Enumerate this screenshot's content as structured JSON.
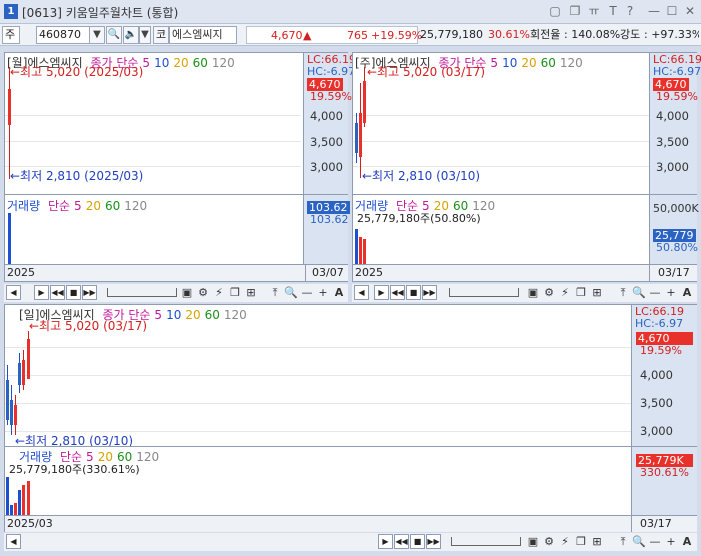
{
  "window": {
    "number": "1",
    "title": "[0613] 키움일주월차트 (통합)",
    "buttons": [
      "▢",
      "❐",
      "ㅠ",
      "T",
      "?",
      "—",
      "☐",
      "✕"
    ]
  },
  "toolbar": {
    "market": "주",
    "code": "460870",
    "code_dd": "▼",
    "search": "🔍",
    "sound": "🔈",
    "sound_dd": "▼",
    "kind": "코",
    "name": "에스엠씨지",
    "price": "4,670",
    "arrow": "▲",
    "change": "765",
    "rate": "+19.59%",
    "volume": "25,779,180",
    "vol_rate": "30.61%",
    "turnover_label": "회전율",
    "turnover": ": 140.08%",
    "strength_label": "강도",
    "strength": ": +97.33%"
  },
  "colors": {
    "up": "#e8312b",
    "down": "#2b63c2",
    "axis_bg": "#d9e3f1"
  },
  "panels": {
    "monthly": {
      "legend": {
        "name": "[월]에스엠씨지",
        "ma": "종가 단순",
        "ma5": "5",
        "ma10": "10",
        "ma20": "20",
        "ma60": "60",
        "ma120": "120"
      },
      "high": "←최고 5,020 (2025/03)",
      "low": "←최저 2,810 (2025/03)",
      "lc": "LC:66.19",
      "hc": "HC:-6.97",
      "price": "4,670",
      "pct": "19.59%",
      "ticks": [
        "4,000",
        "3,500",
        "3,000"
      ],
      "vol_legend": {
        "name": "거래량",
        "ma": "단순",
        "ma5": "5",
        "ma20": "20",
        "ma60": "60",
        "ma120": "120"
      },
      "vol_axis": [
        "103.62",
        "103.62"
      ],
      "date_left": "2025",
      "date_right": "03/07"
    },
    "weekly": {
      "legend": {
        "name": "[주]에스엠씨지",
        "ma": "종가 단순",
        "ma5": "5",
        "ma10": "10",
        "ma20": "20",
        "ma60": "60",
        "ma120": "120"
      },
      "high": "←최고 5,020 (03/17)",
      "low": "←최저 2,810 (03/10)",
      "lc": "LC:66.19",
      "hc": "HC:-6.97",
      "price": "4,670",
      "pct": "19.59%",
      "ticks": [
        "4,000",
        "3,500",
        "3,000"
      ],
      "vol_legend": {
        "name": "거래량",
        "ma": "단순",
        "ma5": "5",
        "ma20": "20",
        "ma60": "60",
        "ma120": "120"
      },
      "vol_text": "25,779,180주(50.80%)",
      "vol_axis": [
        "50,000K",
        "25,779",
        "50.80%"
      ],
      "date_left": "2025",
      "date_right": "03/17"
    },
    "daily": {
      "legend": {
        "name": "[일]에스엠씨지",
        "ma": "종가 단순",
        "ma5": "5",
        "ma10": "10",
        "ma20": "20",
        "ma60": "60",
        "ma120": "120"
      },
      "high": "←최고 5,020 (03/17)",
      "low": "←최저 2,810 (03/10)",
      "lc": "LC:66.19",
      "hc": "HC:-6.97",
      "price": "4,670",
      "pct": "19.59%",
      "ticks": [
        "4,000",
        "3,500",
        "3,000"
      ],
      "vol_legend": {
        "name": "거래량",
        "ma": "단순",
        "ma5": "5",
        "ma20": "20",
        "ma60": "60",
        "ma120": "120"
      },
      "vol_text": "25,779,180주(330.61%)",
      "vol_axis": [
        "25,779K",
        "330.61%"
      ],
      "date_left": "2025/03",
      "date_right": "03/17"
    }
  },
  "nav": {
    "prev": "◀",
    "next": "▶",
    "first": "◀◀",
    "stop": "■",
    "last": "▶▶",
    "tools": [
      "▣",
      "⚙",
      "⚡",
      "❐",
      "⊞",
      "⤒",
      "🔍",
      "—",
      "+",
      "A"
    ]
  }
}
